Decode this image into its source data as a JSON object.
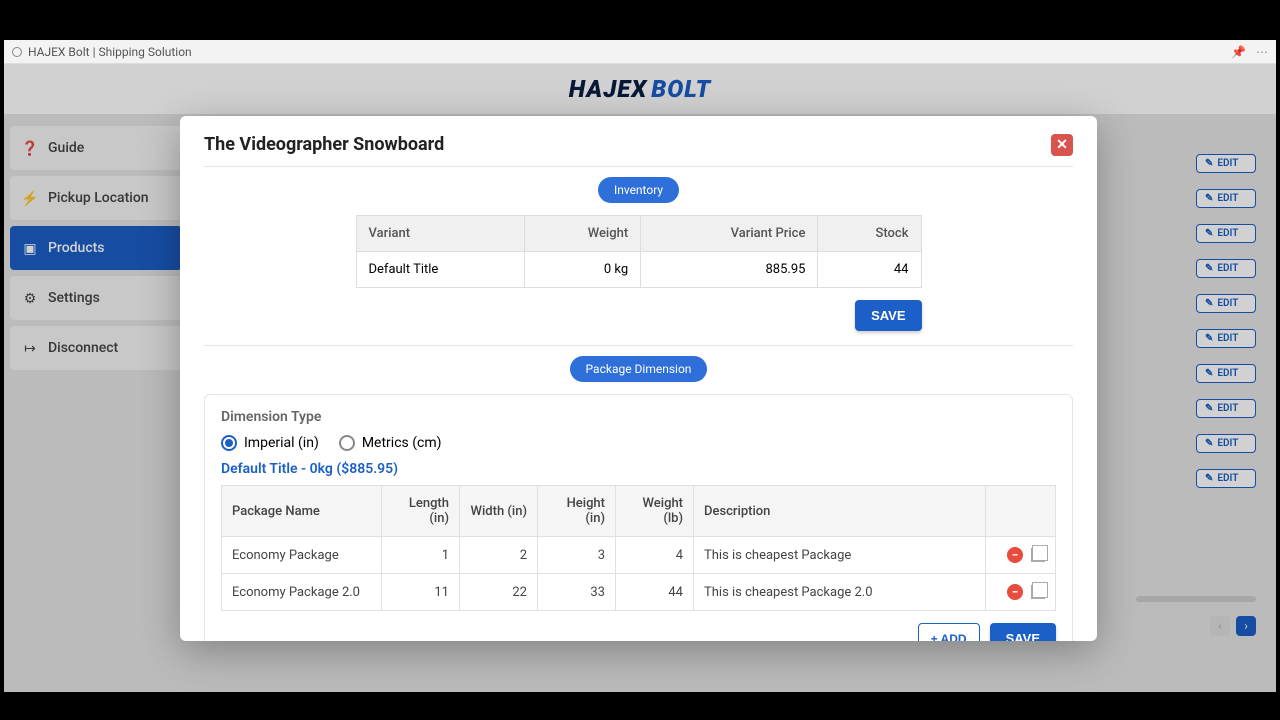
{
  "browser": {
    "title": "HAJEX Bolt | Shipping Solution"
  },
  "logo": {
    "left": "HAJEX",
    "right": "BOLT"
  },
  "sidebar": {
    "items": [
      {
        "label": "Guide",
        "icon": "help-icon"
      },
      {
        "label": "Pickup Location",
        "icon": "zap-icon"
      },
      {
        "label": "Products",
        "icon": "box-icon",
        "active": true
      },
      {
        "label": "Settings",
        "icon": "gear-icon"
      },
      {
        "label": "Disconnect",
        "icon": "logout-icon"
      }
    ]
  },
  "bg_edit_label": "EDIT",
  "bg_edit_rows": [
    0,
    1,
    2,
    3,
    4,
    5,
    6,
    7,
    8,
    9
  ],
  "modal": {
    "title": "The Videographer Snowboard",
    "inventory_pill": "Inventory",
    "inv_headers": {
      "variant": "Variant",
      "weight": "Weight",
      "price": "Variant Price",
      "stock": "Stock"
    },
    "inv_row": {
      "variant": "Default Title",
      "weight": "0 kg",
      "price": "885.95",
      "stock": "44"
    },
    "save_label": "SAVE",
    "dimension_pill": "Package Dimension",
    "dimension_type_label": "Dimension Type",
    "radio_imperial": "Imperial (in)",
    "radio_metrics": "Metrics (cm)",
    "variant_link": "Default Title - 0kg ($885.95)",
    "pkg_headers": {
      "name": "Package Name",
      "length": "Length (in)",
      "width": "Width (in)",
      "height": "Height (in)",
      "weight": "Weight (lb)",
      "desc": "Description"
    },
    "pkg_rows": [
      {
        "name": "Economy Package",
        "length": "1",
        "width": "2",
        "height": "3",
        "weight": "4",
        "desc": "This is cheapest Package"
      },
      {
        "name": "Economy Package 2.0",
        "length": "11",
        "width": "22",
        "height": "33",
        "weight": "44",
        "desc": "This is cheapest Package 2.0"
      }
    ],
    "add_label": "+ ADD",
    "save2_label": "SAVE"
  }
}
